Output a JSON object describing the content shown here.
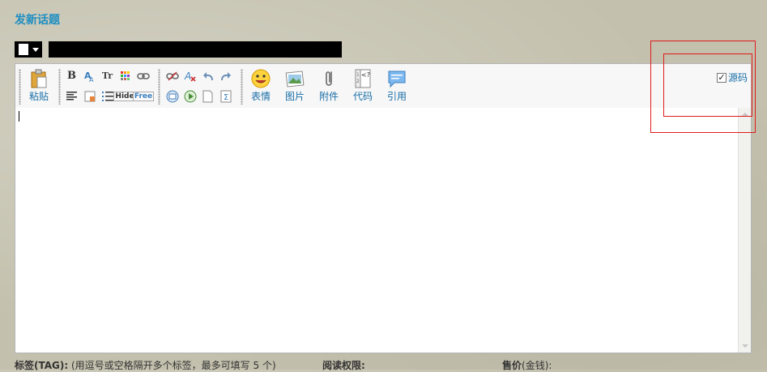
{
  "page": {
    "title": "发新话题"
  },
  "subject": {
    "value": "",
    "type_icon": "document-icon"
  },
  "toolbar": {
    "paste_label": "粘贴",
    "emoticon_label": "表情",
    "image_label": "图片",
    "attachment_label": "附件",
    "code_label": "代码",
    "quote_label": "引用",
    "hide_label": "Hide",
    "free_label": "Free",
    "bold_label": "B",
    "fontsize_label": "Tr",
    "source_label": "源码",
    "source_checked": "✓"
  },
  "footer": {
    "tag_label": "标签(TAG):",
    "tag_hint": "(用逗号或空格隔开多个标签，最多可填写 5 个)",
    "read_perm_label": "阅读权限:",
    "price_label": "售价",
    "price_unit": "(金钱):"
  },
  "colors": {
    "link": "#1c8ec2",
    "highlight": "#e01b1b"
  }
}
